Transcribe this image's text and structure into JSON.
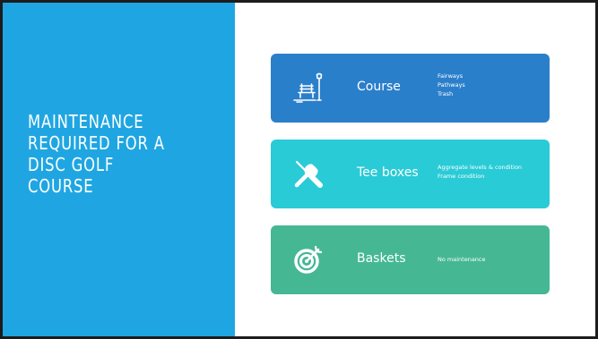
{
  "slide": {
    "title_lines": [
      "Maintenance",
      "required for a",
      "disc golf",
      "course"
    ]
  },
  "cards": [
    {
      "icon": "park-bench-icon",
      "label": "Course",
      "details": [
        "Fairways",
        "Pathways",
        "Trash"
      ],
      "color": "#2a7fcb"
    },
    {
      "icon": "tools-icon",
      "label": "Tee boxes",
      "details": [
        "Aggregate levels & condition",
        "Frame condition"
      ],
      "color": "#29cbd6"
    },
    {
      "icon": "target-icon",
      "label": "Baskets",
      "details": [
        "No maintenance"
      ],
      "color": "#45b893"
    }
  ],
  "colors": {
    "left_panel": "#1fa6e2",
    "border": "#1c1c1c",
    "background": "#ffffff",
    "text": "#ffffff"
  }
}
